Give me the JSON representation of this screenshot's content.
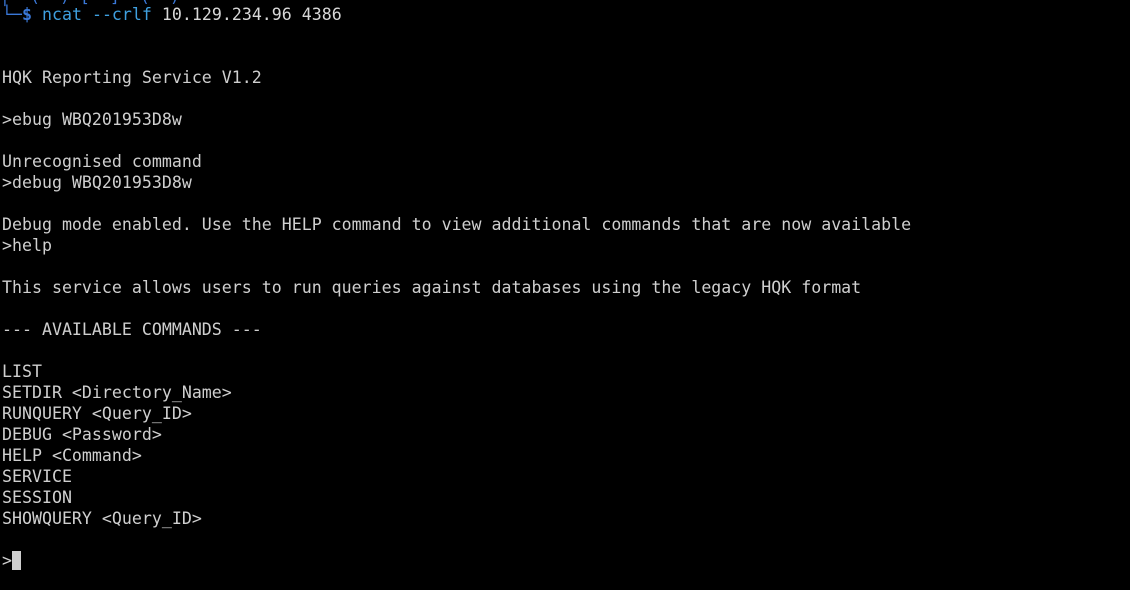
{
  "colors": {
    "background": "#000000",
    "text": "#cfcfcf",
    "prompt_blue": "#3a78d8",
    "command_cyan": "#3fa0e0"
  },
  "prompt": {
    "corner": "└─",
    "symbol": "$",
    "command": "ncat",
    "flag": "--crlf",
    "args": "10.129.234.96 4386"
  },
  "output": {
    "banner": "HQK Reporting Service V1.2",
    "input1": ">ebug WBQ201953D8w",
    "error1": "Unrecognised command",
    "input2": ">debug WBQ201953D8w",
    "debug_msg": "Debug mode enabled. Use the HELP command to view additional commands that are now available",
    "input3": ">help",
    "help_desc": "This service allows users to run queries against databases using the legacy HQK format",
    "commands_header": "--- AVAILABLE COMMANDS ---",
    "commands": [
      "LIST",
      "SETDIR <Directory_Name>",
      "RUNQUERY <Query_ID>",
      "DEBUG <Password>",
      "HELP <Command>",
      "SERVICE",
      "SESSION",
      "SHOWQUERY <Query_ID>"
    ],
    "final_prompt": ">"
  }
}
